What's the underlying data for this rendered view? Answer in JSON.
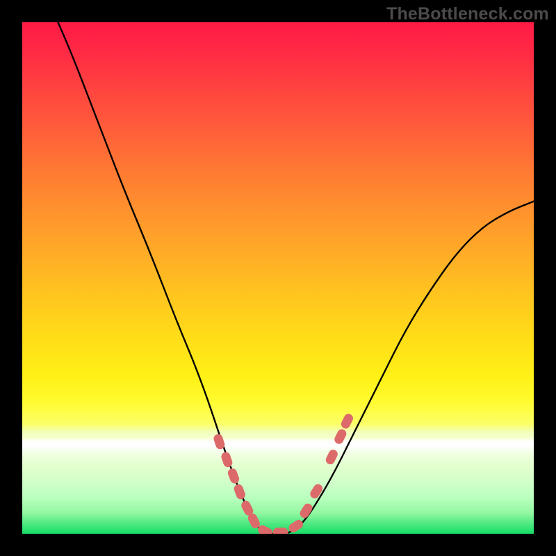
{
  "watermark": "TheBottleneck.com",
  "gradient": {
    "top_color": "#ff1a46",
    "mid_color": "#ffde18",
    "bottom_color": "#17dd66",
    "white_band_fraction": 0.82
  },
  "chart_data": {
    "type": "line",
    "title": "",
    "xlabel": "",
    "ylabel": "",
    "xlim": [
      0,
      1
    ],
    "ylim": [
      0,
      1
    ],
    "note": "Axes are unlabeled; values are normalized estimates from the image. y≈0 is at the bottom (green), y≈1 at the top (red). The curve depicts a bottleneck-style dip reaching ~0 around x≈0.46–0.52.",
    "series": [
      {
        "name": "curve",
        "color": "#000000",
        "x": [
          0.07,
          0.1,
          0.15,
          0.2,
          0.25,
          0.3,
          0.35,
          0.4,
          0.43,
          0.46,
          0.48,
          0.5,
          0.52,
          0.55,
          0.6,
          0.65,
          0.7,
          0.75,
          0.8,
          0.85,
          0.9,
          0.95,
          1.0
        ],
        "y": [
          1.0,
          0.93,
          0.8,
          0.67,
          0.55,
          0.42,
          0.3,
          0.15,
          0.07,
          0.01,
          0.0,
          0.0,
          0.0,
          0.02,
          0.1,
          0.2,
          0.3,
          0.4,
          0.48,
          0.55,
          0.6,
          0.63,
          0.65
        ]
      }
    ],
    "markers": {
      "name": "highlighted-segments",
      "color": "#dd6a6a",
      "shape": "pill",
      "note": "Short thick dashes along the curve near the minimum.",
      "points": [
        {
          "x": 0.385,
          "y": 0.18
        },
        {
          "x": 0.4,
          "y": 0.145
        },
        {
          "x": 0.413,
          "y": 0.113
        },
        {
          "x": 0.425,
          "y": 0.082
        },
        {
          "x": 0.44,
          "y": 0.05
        },
        {
          "x": 0.453,
          "y": 0.025
        },
        {
          "x": 0.475,
          "y": 0.005
        },
        {
          "x": 0.505,
          "y": 0.003
        },
        {
          "x": 0.535,
          "y": 0.015
        },
        {
          "x": 0.555,
          "y": 0.045
        },
        {
          "x": 0.575,
          "y": 0.083
        },
        {
          "x": 0.605,
          "y": 0.15
        },
        {
          "x": 0.622,
          "y": 0.19
        },
        {
          "x": 0.635,
          "y": 0.22
        }
      ]
    }
  }
}
